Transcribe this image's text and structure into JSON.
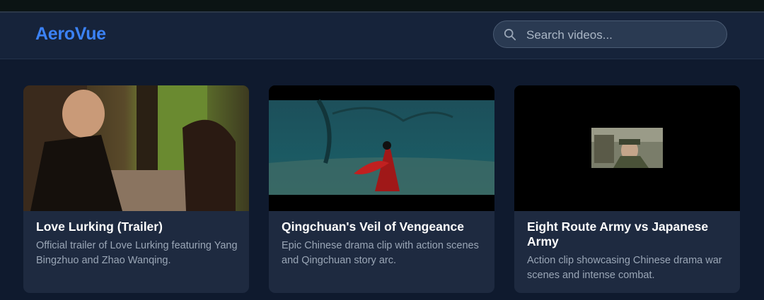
{
  "header": {
    "logo": "AeroVue",
    "search_placeholder": "Search videos..."
  },
  "videos": [
    {
      "title": "Love Lurking (Trailer)",
      "description": "Official trailer of Love Lurking featuring Yang Bingzhuo and Zhao Wanqing."
    },
    {
      "title": "Qingchuan's Veil of Vengeance",
      "description": "Epic Chinese drama clip with action scenes and Qingchuan story arc."
    },
    {
      "title": "Eight Route Army vs Japanese Army",
      "description": "Action clip showcasing Chinese drama war scenes and intense combat."
    }
  ],
  "colors": {
    "accent": "#3b82f6",
    "background": "#0f1a2e",
    "card": "#1e2a40"
  }
}
